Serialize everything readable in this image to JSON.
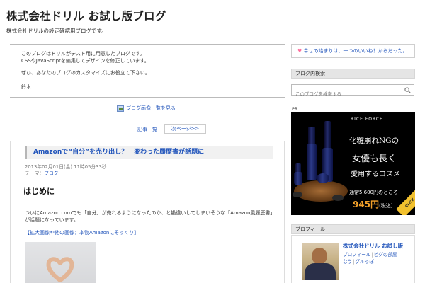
{
  "blog": {
    "title": "株式会社ドリル お試し版ブログ",
    "description": "株式会社ドリルの設定確認用ブログです。"
  },
  "message": {
    "line1": "このブログはドリルがテスト用に用意したブログです。",
    "line2": "CSSやJavaScriptを編集してデザインを修正しています。",
    "line3": "ぜひ、あなたのブログのカスタマイズにお役立て下さい。",
    "signature": "鈴木"
  },
  "photo_list_link": "ブログ画像一覧を見る",
  "pager": {
    "list_label": "記事一覧",
    "next_label": "次ページ>>"
  },
  "article": {
    "title": "Amazonで“自分”を売り出し？　変わった履歴書が話題に",
    "date": "2013年02月01日(金) 11時05分33秒",
    "theme_label": "テーマ：",
    "theme_link": "ブログ",
    "heading": "はじめに",
    "body_line1": "ついにAmazon.comでも「自分」が売れるようになったのか、と勘違いしてしまいそうな「Amazon風履歴書」",
    "body_line2": "が話題になっています。",
    "image_link": "【拡大画像や他の画像：本物Amazonにそっくり】"
  },
  "sidebar": {
    "banner_text": "幸せの始まりは、一つのいいね！からだった。",
    "search_title": "ブログ内検索",
    "search_placeholder": "このブログを検索する",
    "pr_label": "PR",
    "profile_title": "プロフィール",
    "profile_name": "株式会社ドリル お試し版",
    "profile_links": [
      "プロフィール",
      "ピグの部屋",
      "なう",
      "グルっぽ"
    ]
  },
  "ad": {
    "brand": "RICE FORCE",
    "copy1": "化粧崩れNGの",
    "copy2": "女優も長く",
    "copy3": "愛用するコスメ",
    "offer": "通常5,600円のところ",
    "price": "945円",
    "tax": "(税込)",
    "click": "CLICK"
  },
  "colors": {
    "link": "#2255bb",
    "ad_price": "#f2a02a",
    "heart_icon": "#ff6e9c"
  }
}
